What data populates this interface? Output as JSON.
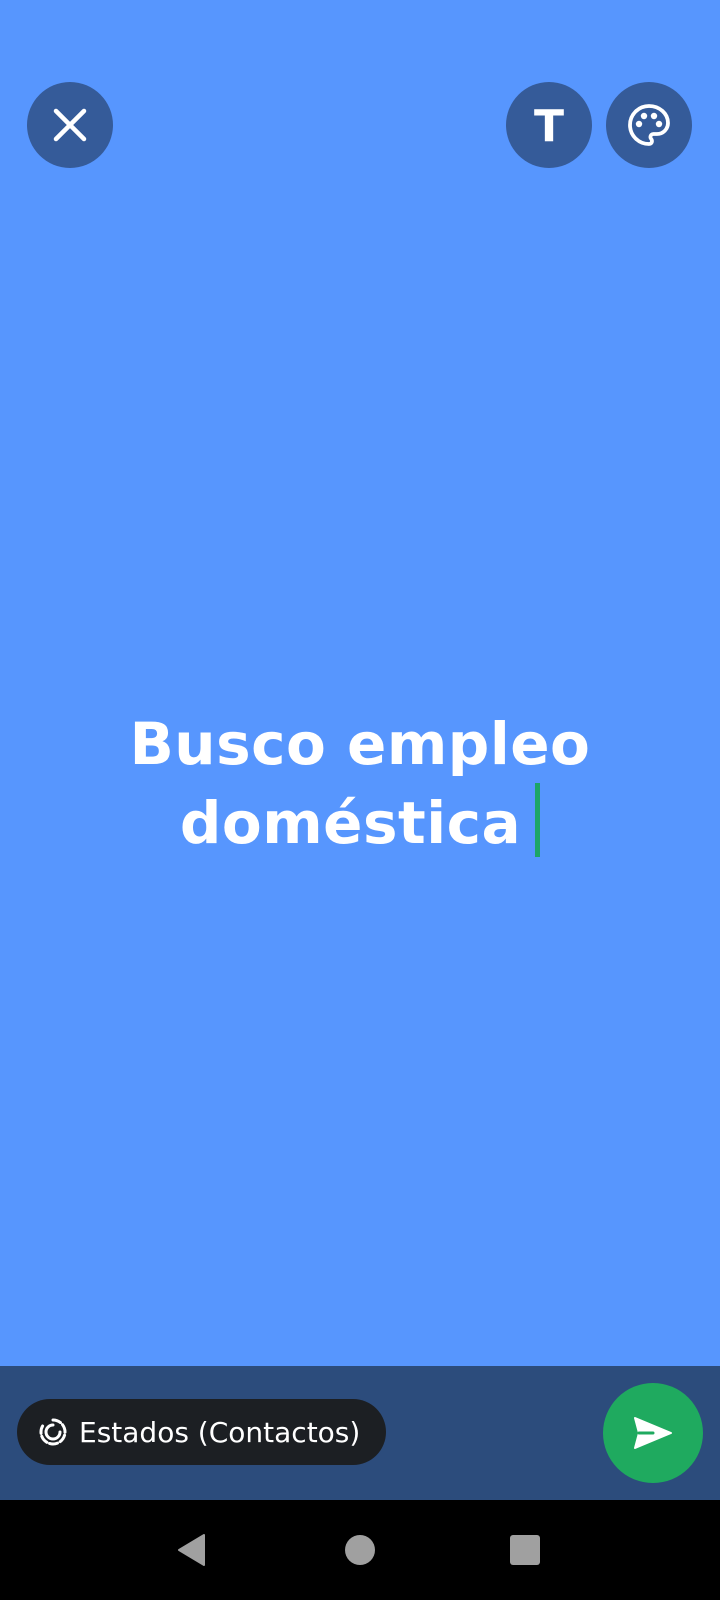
{
  "colors": {
    "canvas_background": "#5796fe",
    "toolbar_button_bg": "#355b99",
    "bottom_bar_bg": "#2c4c7c",
    "audience_pill_bg": "#1c1f23",
    "send_button_bg": "#1faa5f",
    "caret": "#1da566",
    "nav_bar_bg": "#000000",
    "nav_icon": "#a0a0a0",
    "icon": "#ffffff"
  },
  "toolbar": {
    "close_icon": "close-icon",
    "text_style_label": "T",
    "palette_icon": "palette-icon"
  },
  "status": {
    "text": "Busco empleo\ndoméstica"
  },
  "bottom_bar": {
    "audience_icon": "status-ring-icon",
    "audience_label": "Estados (Contactos)",
    "send_icon": "send-icon"
  },
  "nav": {
    "back_icon": "triangle-back-icon",
    "home_icon": "circle-home-icon",
    "recents_icon": "square-recents-icon"
  }
}
